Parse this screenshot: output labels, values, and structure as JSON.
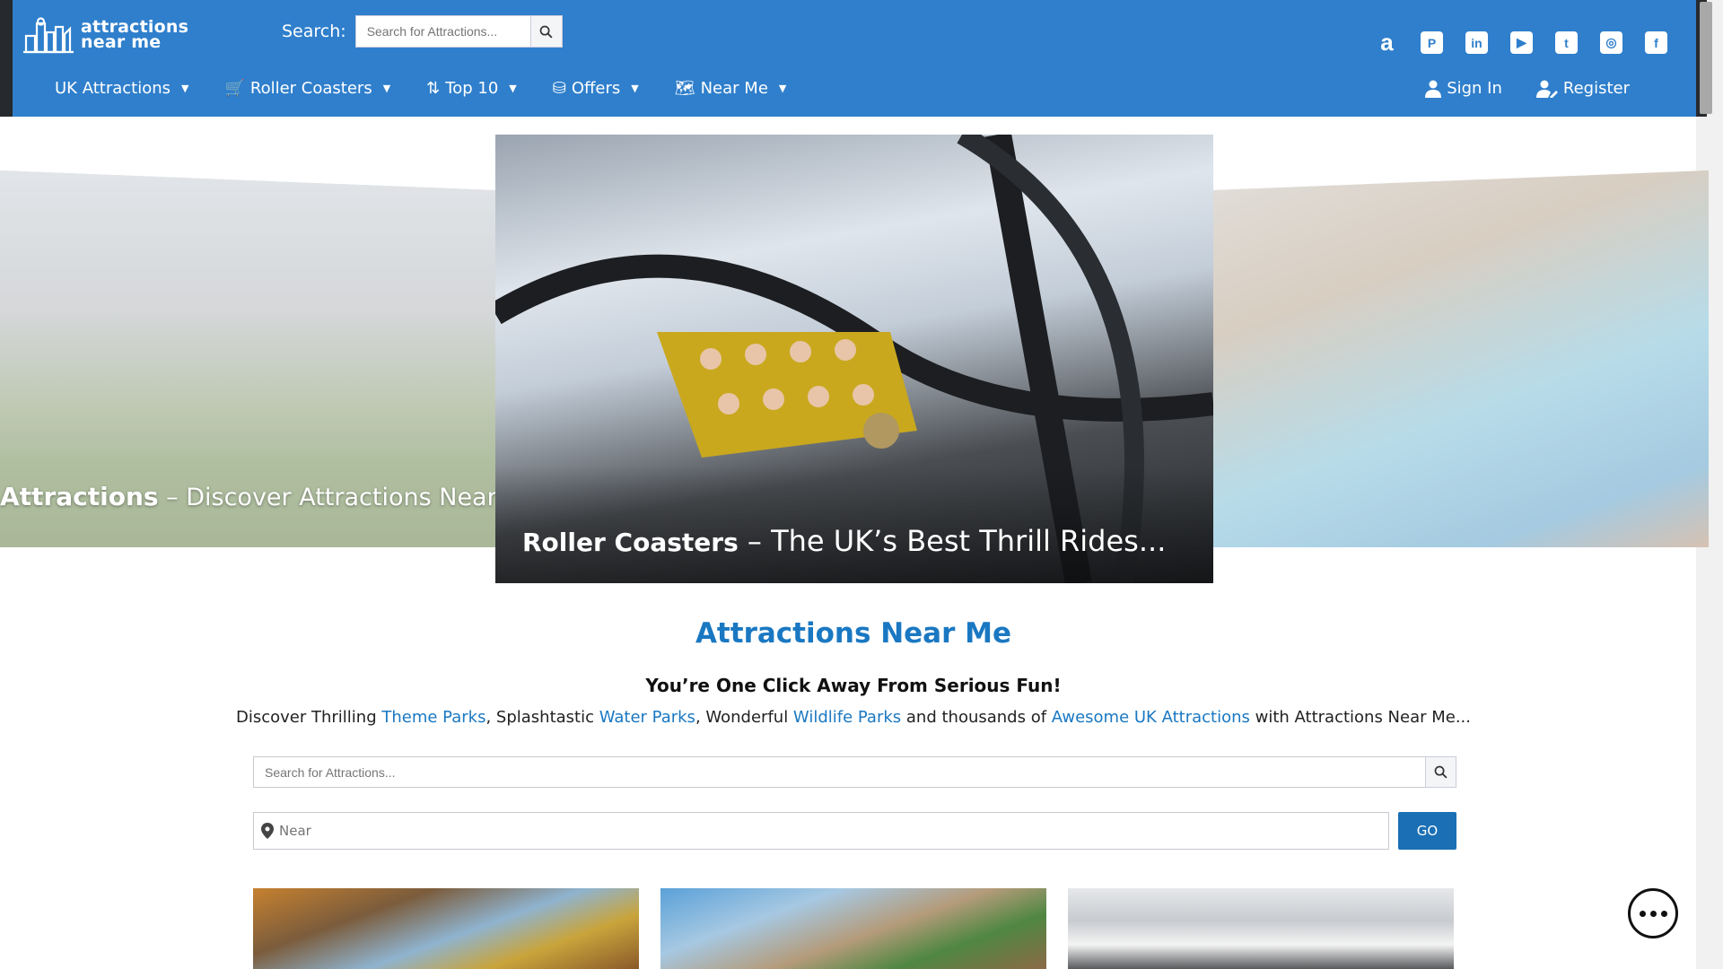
{
  "header": {
    "logo_line1": "attractions",
    "logo_line2": "near me",
    "search_label": "Search:",
    "search_placeholder": "Search for Attractions..."
  },
  "social": [
    "amazon-icon",
    "pinterest-icon",
    "linkedin-icon",
    "youtube-icon",
    "twitter-icon",
    "instagram-icon",
    "facebook-icon"
  ],
  "nav": {
    "items": [
      {
        "label": "UK Attractions",
        "icon": ""
      },
      {
        "label": "Roller Coasters",
        "icon": "cart-icon"
      },
      {
        "label": "Top 10",
        "icon": "sort-icon"
      },
      {
        "label": "Offers",
        "icon": "coins-icon"
      },
      {
        "label": "Near Me",
        "icon": "map-icon"
      }
    ],
    "sign_in": "Sign In",
    "register": "Register"
  },
  "slider": {
    "left": {
      "caption_bold": "Attractions",
      "caption_rest": " – Discover Attractions Near You..."
    },
    "center": {
      "caption_bold": "Roller Coasters",
      "caption_rest": " – The UK’s Best Thrill Rides..."
    }
  },
  "content": {
    "title": "Attractions Near Me",
    "subtitle": "You’re One Click Away From Serious Fun!",
    "desc": {
      "t1": "Discover Thrilling ",
      "l1": "Theme Parks",
      "t2": ", Splashtastic ",
      "l2": "Water Parks",
      "t3": ", Wonderful ",
      "l3": "Wildlife Parks",
      "t4": " and thousands of ",
      "l4": "Awesome UK Attractions",
      "t5": " with Attractions Near Me..."
    },
    "search_placeholder": "Search for Attractions...",
    "near_placeholder": "Near",
    "go_label": "GO"
  },
  "colors": {
    "header_bg": "#2f7fcc",
    "accent": "#1a78c2",
    "button": "#1a6fb5"
  }
}
